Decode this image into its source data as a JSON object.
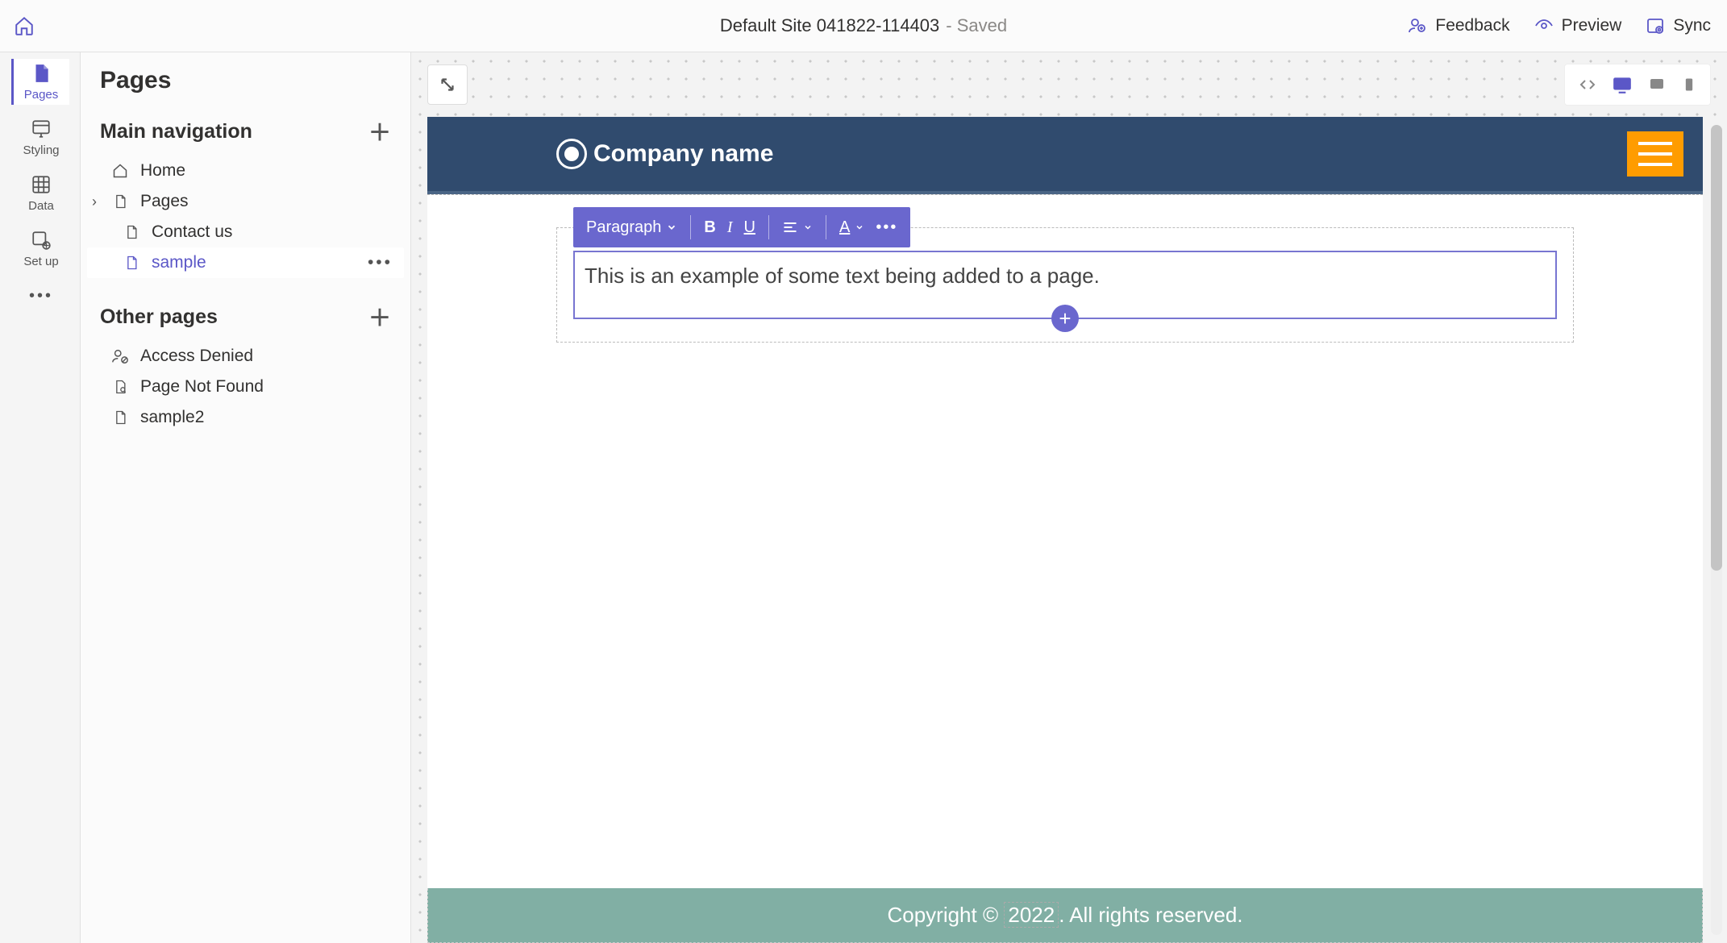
{
  "header": {
    "site_title": "Default Site 041822-114403",
    "status": "- Saved",
    "actions": {
      "feedback": "Feedback",
      "preview": "Preview",
      "sync": "Sync"
    }
  },
  "toolstrip": {
    "pages": "Pages",
    "styling": "Styling",
    "data": "Data",
    "setup": "Set up"
  },
  "panel": {
    "title": "Pages",
    "main_nav_label": "Main navigation",
    "other_label": "Other pages",
    "main_nav": [
      {
        "label": "Home"
      },
      {
        "label": "Pages"
      },
      {
        "label": "Contact us"
      },
      {
        "label": "sample"
      }
    ],
    "other": [
      {
        "label": "Access Denied"
      },
      {
        "label": "Page Not Found"
      },
      {
        "label": "sample2"
      }
    ]
  },
  "editor": {
    "format_label": "Paragraph",
    "text": "This is an example of some text being added to a page."
  },
  "site": {
    "company": "Company name",
    "footer_prefix": "Copyright © ",
    "footer_year": "2022",
    "footer_suffix": ". All rights reserved."
  }
}
